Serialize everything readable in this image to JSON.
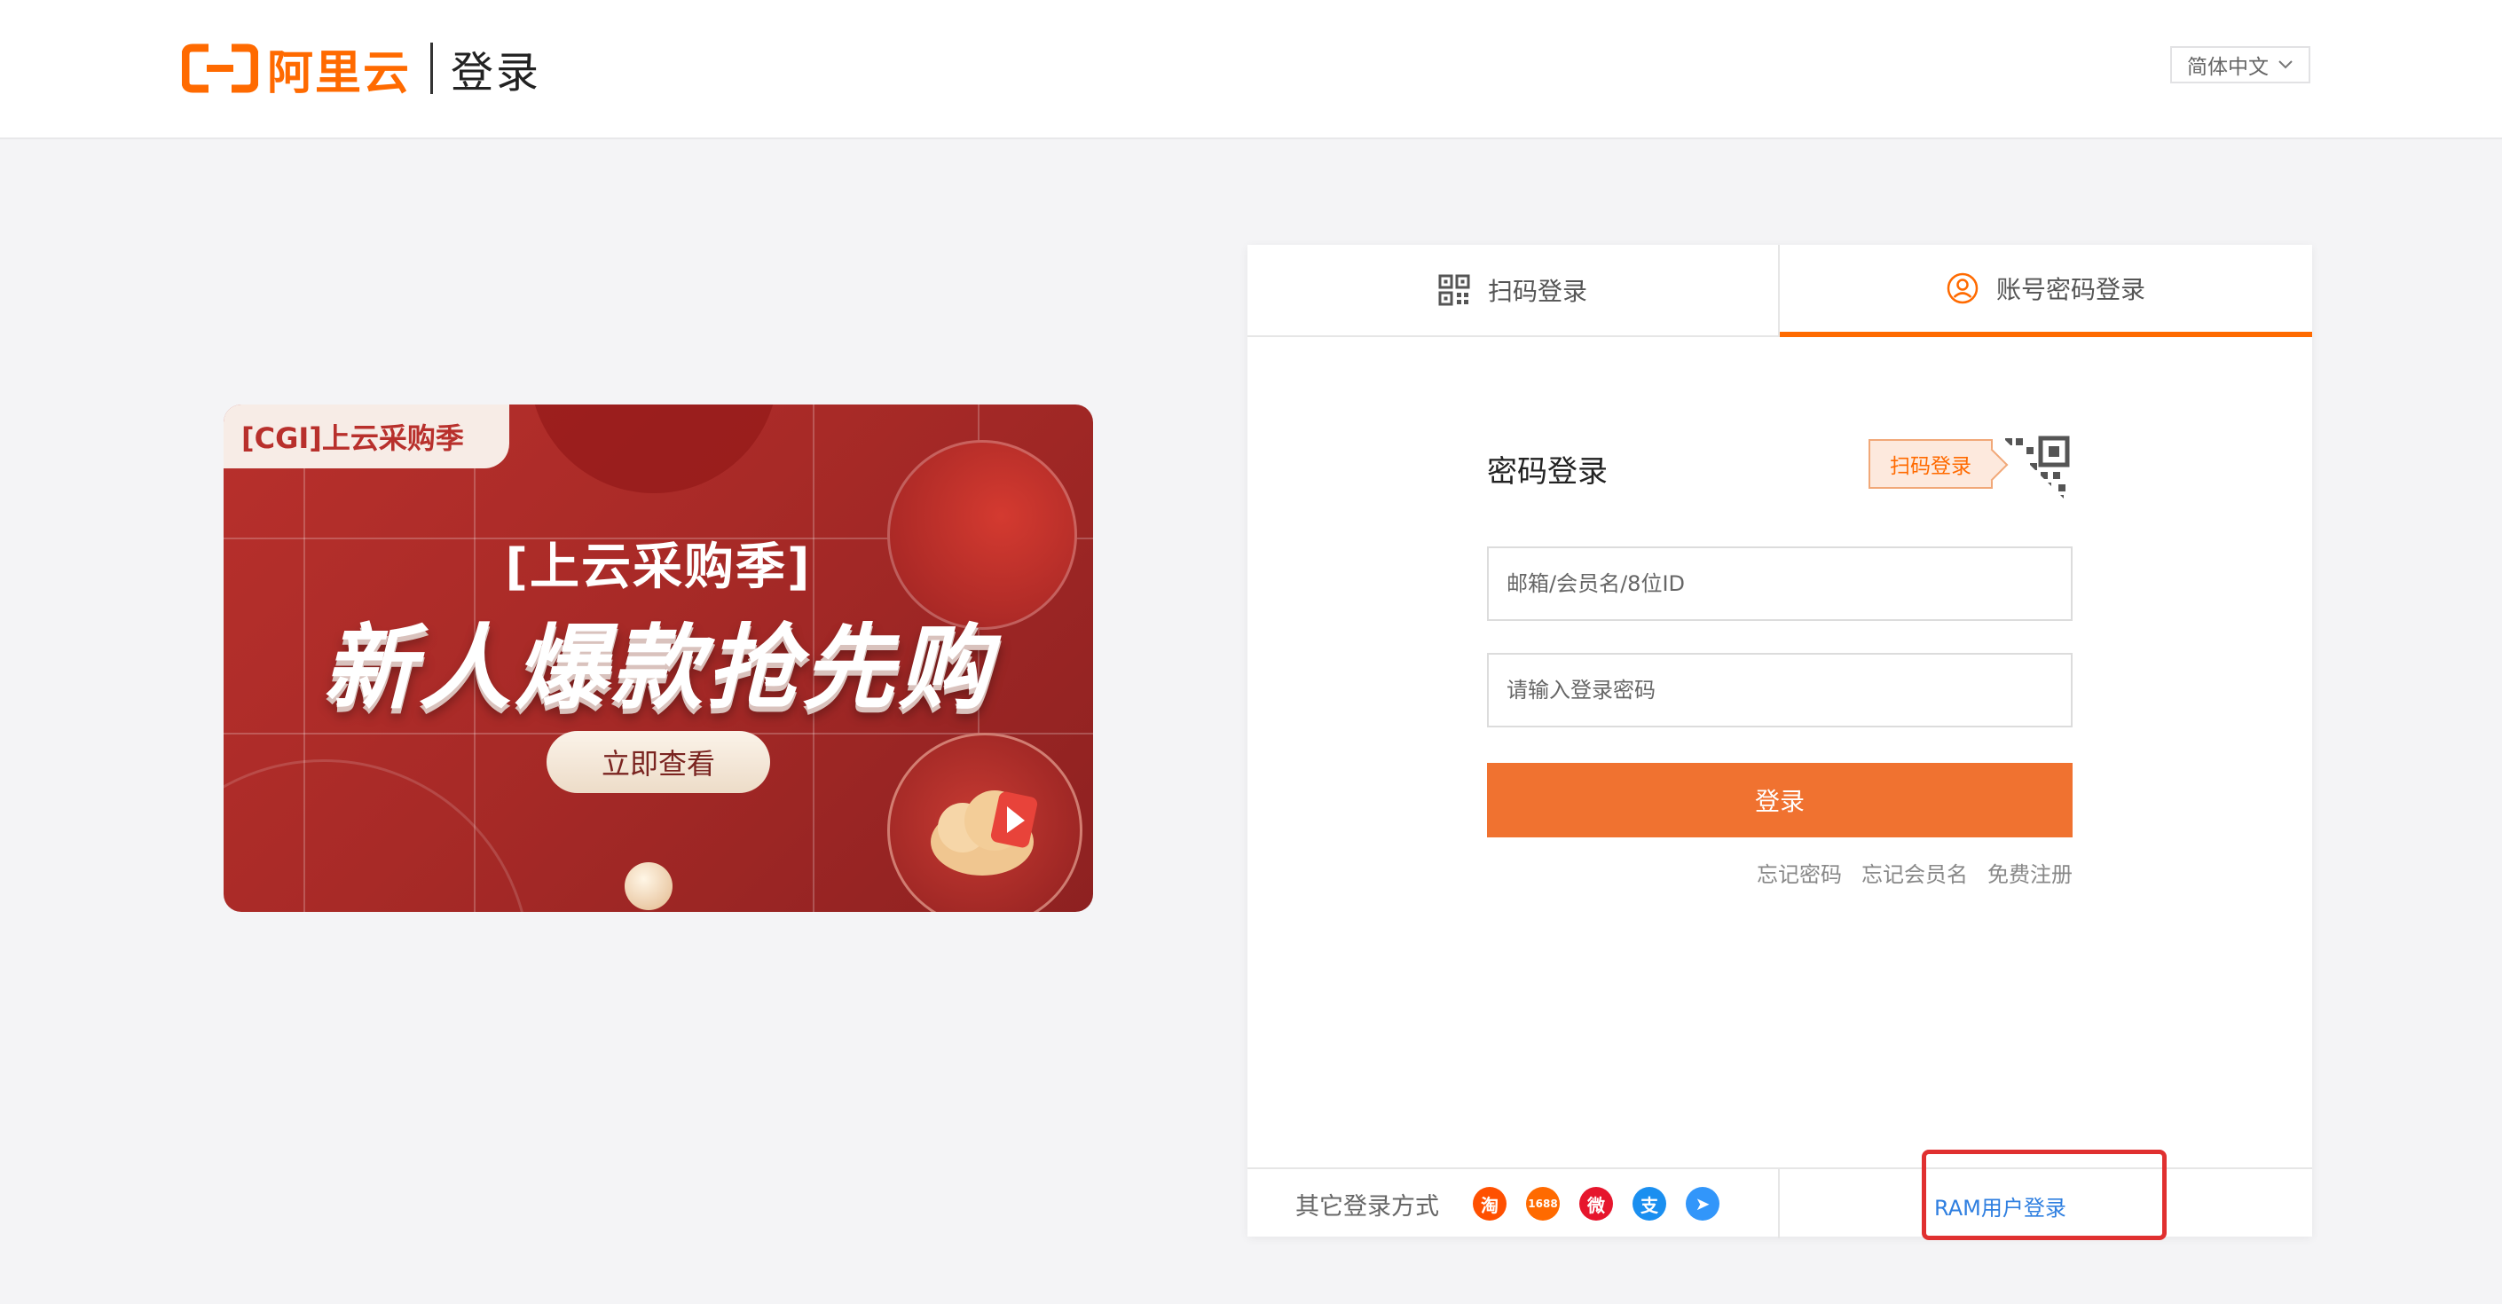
{
  "header": {
    "brand_name": "阿里云",
    "page_name": "登录",
    "language": "简体中文"
  },
  "banner": {
    "tag": "[CGI]上云采购季",
    "subtitle": "[上云采购季]",
    "title": "新人爆款抢先购",
    "cta_label": "立即查看"
  },
  "tabs": [
    {
      "label": "扫码登录",
      "icon": "qr-code-icon",
      "active": false
    },
    {
      "label": "账号密码登录",
      "icon": "user-icon",
      "active": true
    }
  ],
  "form": {
    "title": "密码登录",
    "qr_tip": "扫码登录",
    "username_placeholder": "邮箱/会员名/8位ID",
    "password_placeholder": "请输入登录密码",
    "submit_label": "登录",
    "links": [
      "忘记密码",
      "忘记会员名",
      "免费注册"
    ]
  },
  "footer": {
    "other_label": "其它登录方式",
    "providers": [
      {
        "name": "taobao",
        "glyph": "淘",
        "color": "#ff5000"
      },
      {
        "name": "1688",
        "glyph": "1688",
        "color": "#ff6a00"
      },
      {
        "name": "weibo",
        "glyph": "微",
        "color": "#e6162d"
      },
      {
        "name": "alipay",
        "glyph": "支",
        "color": "#1a8ff0"
      },
      {
        "name": "dingtalk",
        "glyph": "➤",
        "color": "#3296fa"
      }
    ],
    "ram_label": "RAM用户登录"
  },
  "colors": {
    "brand_orange": "#ff6a00",
    "button_orange": "#f07230",
    "link_blue": "#2f7fe0",
    "highlight_red": "#e03030"
  }
}
